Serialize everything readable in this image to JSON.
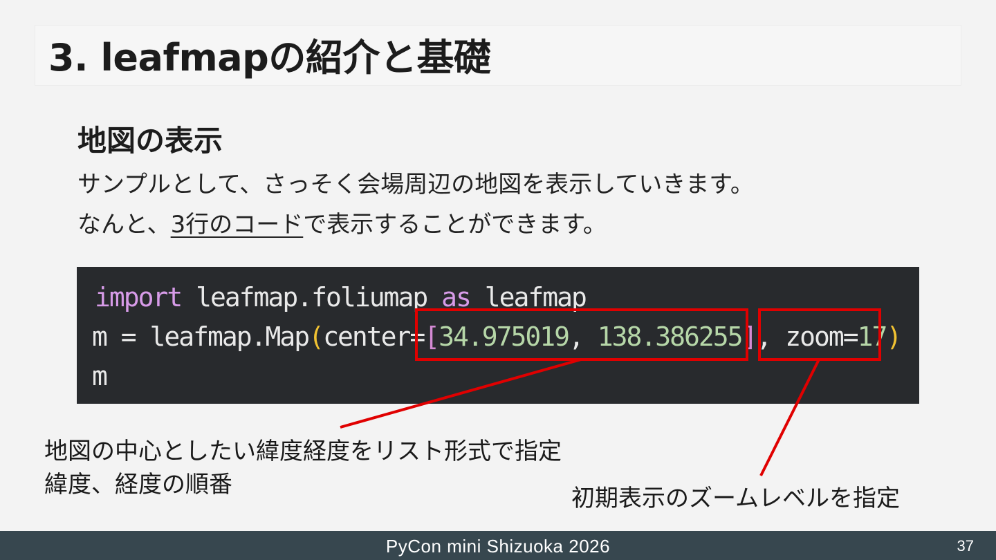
{
  "slide": {
    "title": "3. leafmapの紹介と基礎",
    "section_heading": "地図の表示",
    "paragraph_1": "サンプルとして、さっそく会場周辺の地図を表示していきます。",
    "paragraph_2_prefix": "なんと、",
    "paragraph_2_underlined": "3行のコード",
    "paragraph_2_suffix": "で表示することができます。"
  },
  "code": {
    "line_1": {
      "keyword_import": "import",
      "module": " leafmap.foliumap ",
      "keyword_as": "as",
      "alias": " leafmap"
    },
    "line_2": {
      "prefix": "m = leafmap.Map",
      "open_paren": "(",
      "center_arg": "center=",
      "open_bracket": "[",
      "latitude": "34.975019",
      "comma": ", ",
      "longitude": "138.386255",
      "close_bracket": "]",
      "separator": ", zoom=",
      "zoom": "17",
      "close_paren": ")"
    },
    "line_3": "m"
  },
  "annotations": {
    "coords_note_line_1": "地図の中心としたい緯度経度をリスト形式で指定",
    "coords_note_line_2": "緯度、経度の順番",
    "zoom_note": "初期表示のズームレベルを指定",
    "highlight_color": "#e00000"
  },
  "footer": {
    "event": "PyCon mini Shizuoka 2026",
    "page_number": "37",
    "background_color": "#37474f"
  },
  "colors": {
    "slide_background": "#f3f3f3",
    "code_background": "#282a2d",
    "code_keyword": "#d79be8",
    "code_number": "#b6d7a8",
    "code_paren": "#f1c232"
  }
}
